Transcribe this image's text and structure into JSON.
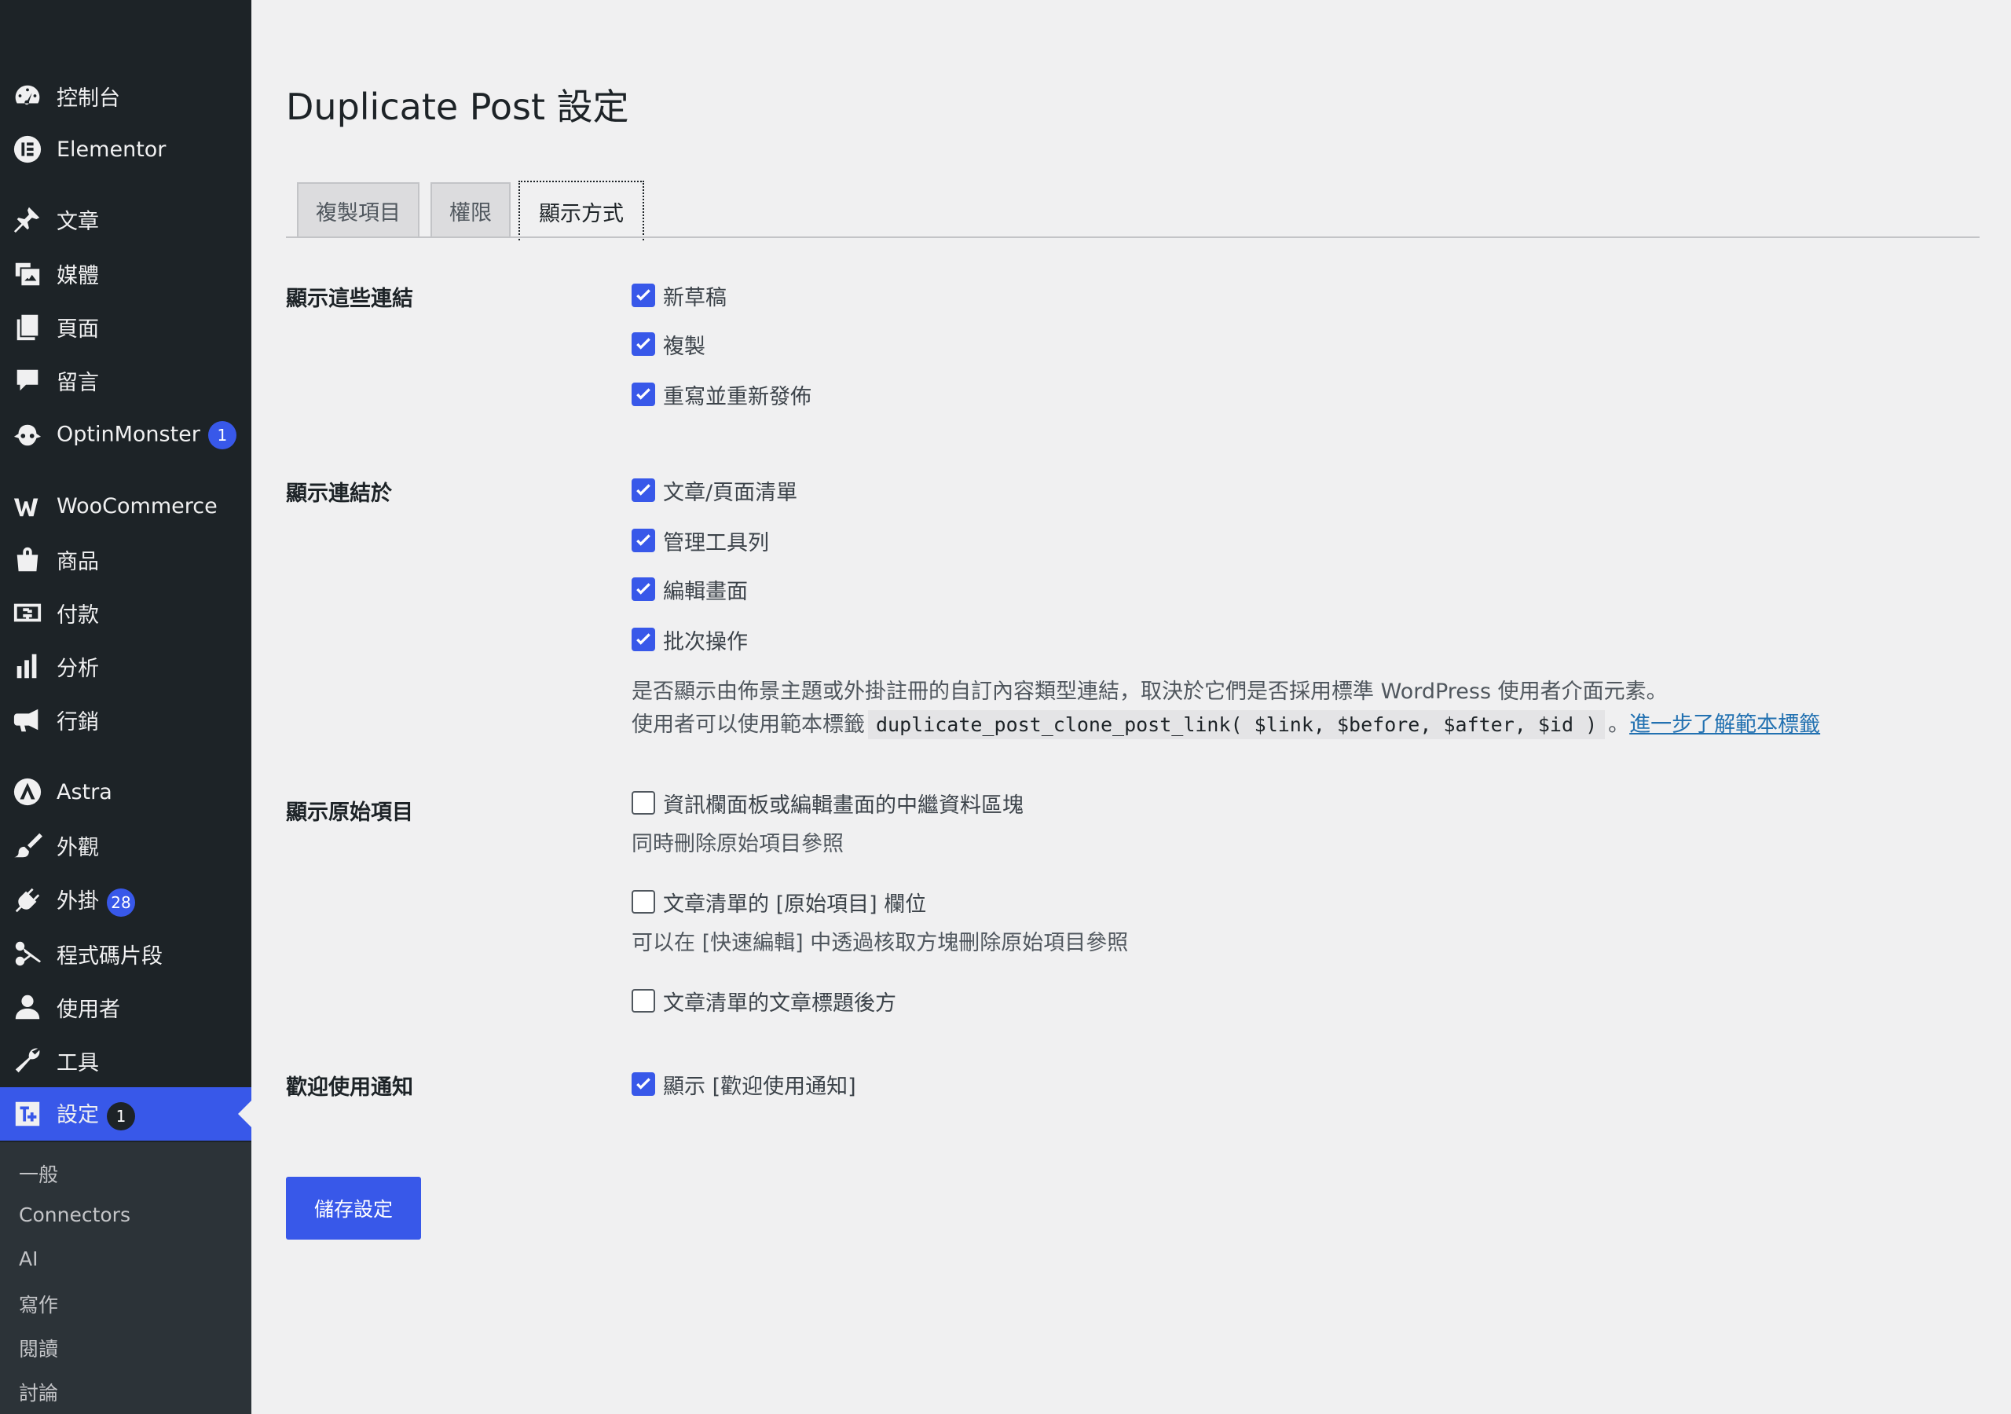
{
  "sidebar": {
    "items": [
      {
        "label": "控制台",
        "icon": "dashboard-icon"
      },
      {
        "label": "Elementor",
        "icon": "elementor-icon"
      },
      {
        "label": "文章",
        "icon": "pin-icon"
      },
      {
        "label": "媒體",
        "icon": "media-icon"
      },
      {
        "label": "頁面",
        "icon": "page-icon"
      },
      {
        "label": "留言",
        "icon": "comment-icon"
      },
      {
        "label": "OptinMonster",
        "icon": "optinmonster-icon",
        "badge": "1"
      },
      {
        "label": "WooCommerce",
        "icon": "woocommerce-icon"
      },
      {
        "label": "商品",
        "icon": "products-icon"
      },
      {
        "label": "付款",
        "icon": "payments-icon"
      },
      {
        "label": "分析",
        "icon": "analytics-icon"
      },
      {
        "label": "行銷",
        "icon": "megaphone-icon"
      },
      {
        "label": "Astra",
        "icon": "astra-icon"
      },
      {
        "label": "外觀",
        "icon": "brush-icon"
      },
      {
        "label": "外掛",
        "icon": "plugin-icon",
        "badge": "28"
      },
      {
        "label": "程式碼片段",
        "icon": "scissors-icon"
      },
      {
        "label": "使用者",
        "icon": "user-icon"
      },
      {
        "label": "工具",
        "icon": "wrench-icon"
      },
      {
        "label": "設定",
        "icon": "settings-icon",
        "badge": "1",
        "active": true
      }
    ],
    "submenu": [
      "一般",
      "Connectors",
      "AI",
      "寫作",
      "閱讀",
      "討論"
    ]
  },
  "page": {
    "title": "Duplicate Post 設定",
    "tabs": [
      "複製項目",
      "權限",
      "顯示方式"
    ],
    "active_tab": "顯示方式"
  },
  "sections": {
    "show_links": {
      "label": "顯示這些連結",
      "options": [
        {
          "label": "新草稿",
          "checked": true
        },
        {
          "label": "複製",
          "checked": true
        },
        {
          "label": "重寫並重新發佈",
          "checked": true
        }
      ]
    },
    "show_links_in": {
      "label": "顯示連結於",
      "options": [
        {
          "label": "文章/頁面清單",
          "checked": true
        },
        {
          "label": "管理工具列",
          "checked": true
        },
        {
          "label": "編輯畫面",
          "checked": true
        },
        {
          "label": "批次操作",
          "checked": true
        }
      ],
      "desc_line1": "是否顯示由佈景主題或外掛註冊的自訂內容類型連結，取決於它們是否採用標準 WordPress 使用者介面元素。",
      "desc_line2_prefix": "使用者可以使用範本標籤",
      "desc_code": "duplicate_post_clone_post_link( $link, $before, $after, $id )",
      "desc_sep": "。",
      "desc_link": "進一步了解範本標籤"
    },
    "show_original": {
      "label": "顯示原始項目",
      "options": [
        {
          "label": "資訊欄面板或編輯畫面的中繼資料區塊",
          "checked": false,
          "desc": "同時刪除原始項目參照"
        },
        {
          "label": "文章清單的 [原始項目] 欄位",
          "checked": false,
          "desc": "可以在 [快速編輯] 中透過核取方塊刪除原始項目參照"
        },
        {
          "label": "文章清單的文章標題後方",
          "checked": false
        }
      ]
    },
    "welcome": {
      "label": "歡迎使用通知",
      "options": [
        {
          "label": "顯示 [歡迎使用通知]",
          "checked": true
        }
      ]
    }
  },
  "save_button": "儲存設定",
  "colors": {
    "sidebar_bg": "#1d2327",
    "accent": "#3858e9",
    "page_bg": "#f0f0f1",
    "link": "#2271b1"
  }
}
